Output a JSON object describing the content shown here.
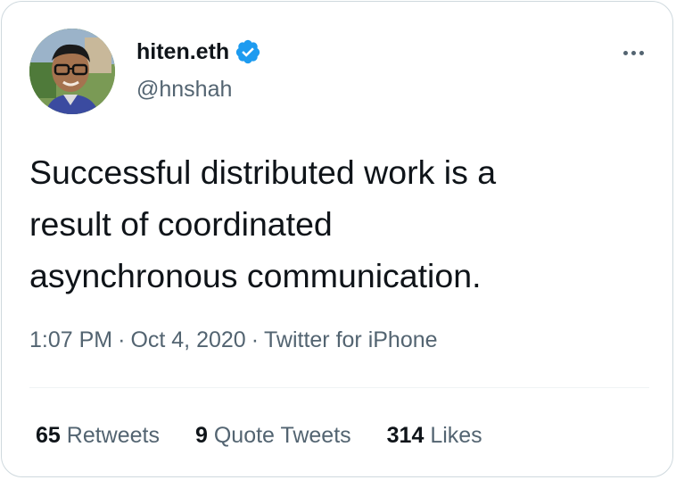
{
  "tweet": {
    "author": {
      "display_name": "hiten.eth",
      "handle": "@hnshah",
      "verified": true
    },
    "text_lines": [
      "Successful distributed work is a",
      "result of coordinated",
      "asynchronous communication."
    ],
    "meta": {
      "time": "1:07 PM",
      "separator": "·",
      "date": "Oct 4, 2020",
      "source": "Twitter for iPhone"
    },
    "stats": {
      "retweets_count": "65",
      "retweets_label": "Retweets",
      "quotes_count": "9",
      "quotes_label": "Quote Tweets",
      "likes_count": "314",
      "likes_label": "Likes"
    }
  },
  "colors": {
    "verified_blue": "#1d9bf0",
    "secondary_text": "#536471",
    "primary_text": "#0f1419",
    "border": "#cfd9de"
  },
  "icons": {
    "verified": "verified-badge-icon",
    "more": "more-options-icon"
  }
}
